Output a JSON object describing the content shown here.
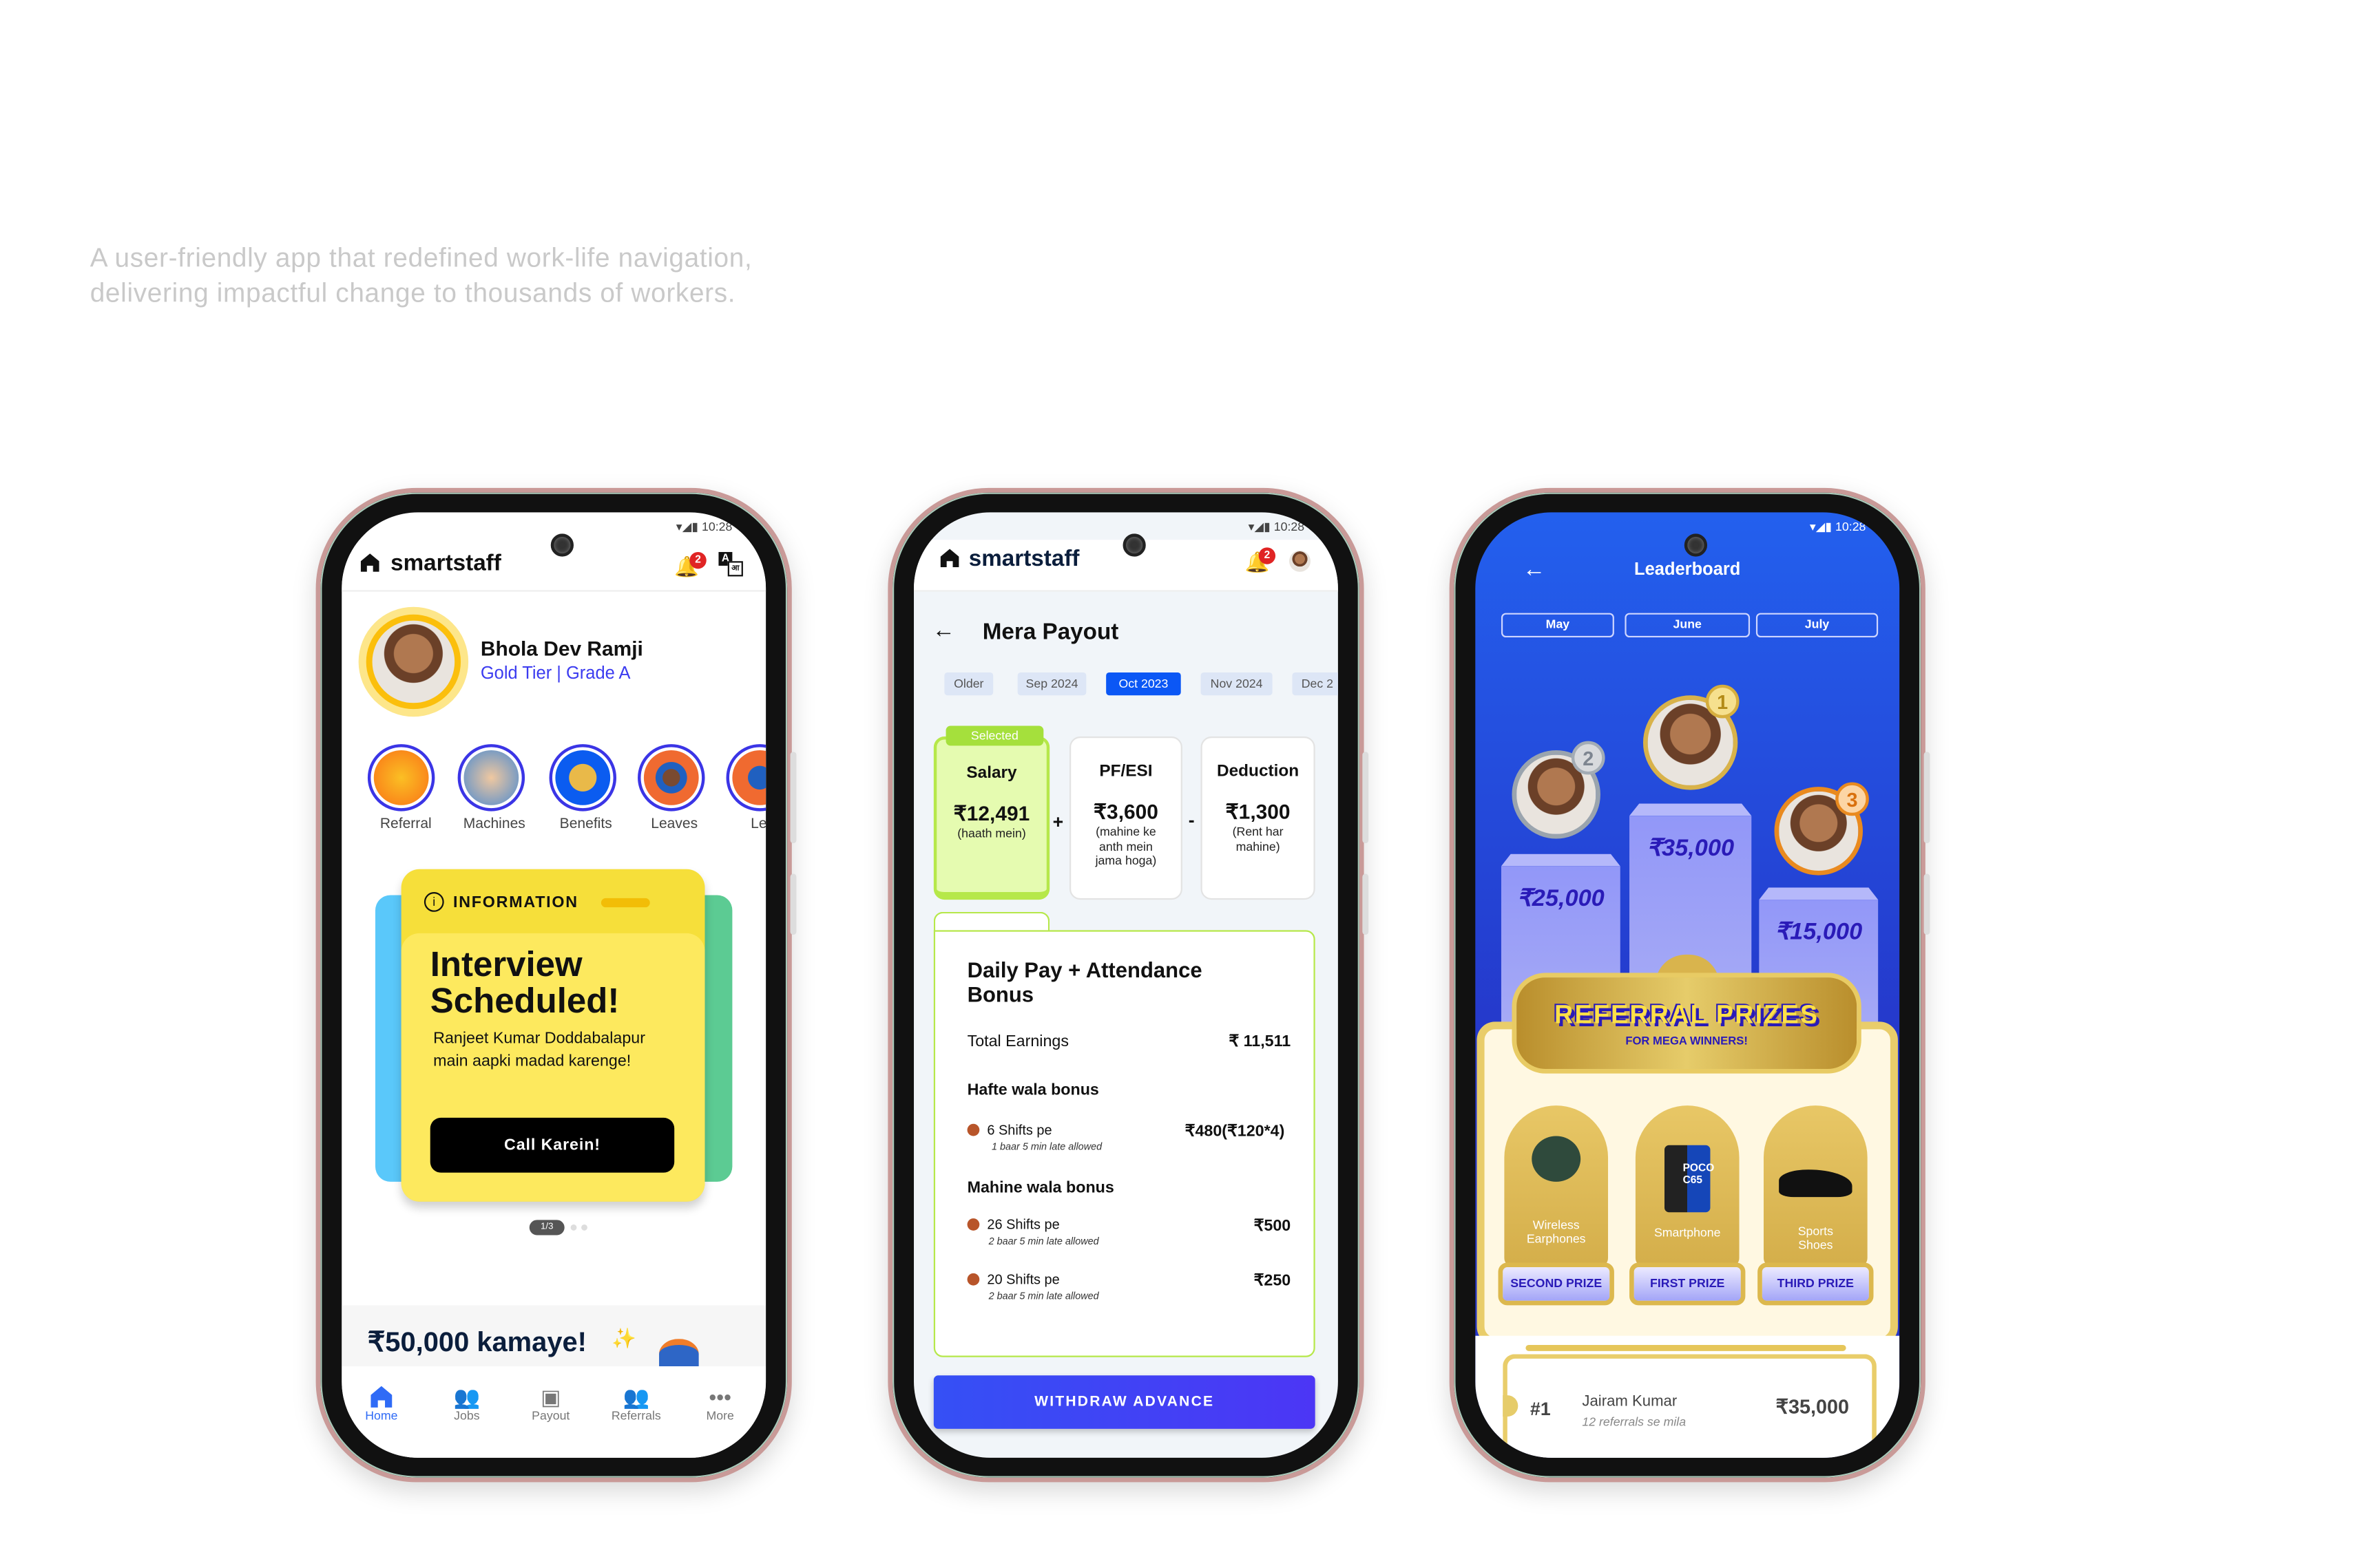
{
  "tagline": [
    "A user-friendly app that redefined work-life navigation,",
    "delivering impactful change to thousands of workers."
  ],
  "colors": {
    "brand_blue": "#3b35e6",
    "accent_yellow": "#fbe35c",
    "selected_green": "#b6e84a",
    "leaderboard_bg": "#2456e8",
    "gold": "#d8b24a"
  },
  "status_bar": {
    "time": "10:28"
  },
  "app": {
    "name": "smartstaff",
    "notification_count": "2",
    "language_icon_text": "A आ"
  },
  "home": {
    "profile": {
      "name": "Bhola Dev Ramji",
      "tier": "Gold Tier | Grade A"
    },
    "shortcuts": [
      {
        "label": "Referral",
        "icon": "wallet-coins-icon"
      },
      {
        "label": "Machines",
        "icon": "machines-photo-icon"
      },
      {
        "label": "Benefits",
        "icon": "medal-icon"
      },
      {
        "label": "Leaves",
        "icon": "worker-photo-icon"
      },
      {
        "label": "Lea",
        "icon": "worker-photo-icon"
      }
    ],
    "info_card": {
      "tag": "INFORMATION",
      "title": "Interview Scheduled!",
      "body": "Ranjeet Kumar Doddabalapur main aapki madad karenge!",
      "button": "Call Karein!"
    },
    "pager": "1/3",
    "earn_banner": "₹50,000 kamaye!",
    "nav": [
      {
        "label": "Home",
        "icon": "home-icon",
        "active": true
      },
      {
        "label": "Jobs",
        "icon": "jobs-icon"
      },
      {
        "label": "Payout",
        "icon": "payout-icon"
      },
      {
        "label": "Referrals",
        "icon": "referrals-icon"
      },
      {
        "label": "More",
        "icon": "more-icon"
      }
    ]
  },
  "payout": {
    "title": "Mera Payout",
    "months": [
      "Older",
      "Sep 2024",
      "Oct 2023",
      "Nov 2024",
      "Dec 2"
    ],
    "selected_month": "Oct 2023",
    "selected_tag": "Selected",
    "cards": [
      {
        "title": "Salary",
        "amount": "₹12,491",
        "note": "(haath mein)"
      },
      {
        "title": "PF/ESI",
        "amount": "₹3,600",
        "note": "(mahine ke anth mein jama hoga)"
      },
      {
        "title": "Deduction",
        "amount": "₹1,300",
        "note": "(Rent har mahine)"
      }
    ],
    "operators": [
      "+",
      "-"
    ],
    "details": {
      "title": "Daily Pay + Attendance Bonus",
      "total_label": "Total Earnings",
      "total_value": "₹ 11,511",
      "weekly_label": "Hafte wala bonus",
      "weekly": [
        {
          "label": "6 Shifts pe",
          "note": "1 baar 5 min late allowed",
          "value": "₹480(₹120*4)"
        }
      ],
      "monthly_label": "Mahine wala bonus",
      "monthly": [
        {
          "label": "26 Shifts pe",
          "note": "2 baar 5 min late allowed",
          "value": "₹500"
        },
        {
          "label": "20 Shifts pe",
          "note": "2 baar 5 min late allowed",
          "value": "₹250"
        }
      ]
    },
    "withdraw_button": "WITHDRAW ADVANCE"
  },
  "leaderboard": {
    "title": "Leaderboard",
    "months": [
      "May",
      "June",
      "July"
    ],
    "podium": [
      {
        "rank": "2",
        "amount": "₹25,000"
      },
      {
        "rank": "1",
        "amount": "₹35,000"
      },
      {
        "rank": "3",
        "amount": "₹15,000"
      }
    ],
    "banner_title": "REFERRAL PRIZES",
    "banner_subtitle": "FOR MEGA WINNERS!",
    "prizes": [
      {
        "item": "Wireless Earphones",
        "label": "SECOND PRIZE",
        "icon": "earphones-icon"
      },
      {
        "item": "Smartphone",
        "label": "FIRST PRIZE",
        "icon": "smartphone-icon",
        "phone_text": "POCO C65"
      },
      {
        "item": "Sports Shoes",
        "label": "THIRD PRIZE",
        "icon": "shoes-icon"
      }
    ],
    "list": [
      {
        "rank": "#1",
        "name": "Jairam Kumar",
        "note": "12 referrals se mila",
        "amount": "₹35,000"
      }
    ]
  }
}
